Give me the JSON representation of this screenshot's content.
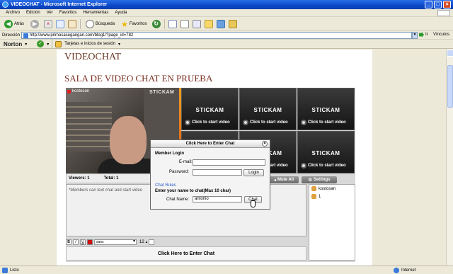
{
  "window": {
    "title": "VIDEOCHAT - Microsoft Internet Explorer"
  },
  "menu": [
    "Archivo",
    "Edición",
    "Ver",
    "Favoritos",
    "Herramientas",
    "Ayuda"
  ],
  "toolbar": {
    "back": "Atrás",
    "search": "Búsqueda",
    "favorites": "Favoritos"
  },
  "address": {
    "label": "Dirección",
    "url": "http://www.primosasegangan.com/blog1/?page_id=782",
    "go": "Ir",
    "links": "Vínculos"
  },
  "norton": {
    "brand": "Norton",
    "cards": "Tarjetas e inicios de sesión"
  },
  "page": {
    "title": "VIDEOCHAT",
    "subtitle": "SALA DE VIDEO CHAT EN PRUEBA"
  },
  "widget": {
    "cam_user": "kostosan",
    "brand": "STICKAM",
    "cta": "Click to start video",
    "viewers": "Viewers: 1",
    "total": "Total: 1",
    "mute_all": "Mute All",
    "settings": "Settings",
    "chat_notice": "*Members can text chat and start video",
    "users": [
      "kostosan",
      "1"
    ],
    "font": "sans",
    "font_size": "12",
    "enter_chat": "Click Here to Enter Chat"
  },
  "dialog": {
    "title": "Click Here to Enter Chat",
    "member_login": "Member Login",
    "email_label": "E-mail:",
    "password_label": "Password:",
    "login_btn": "Login",
    "chat_rules": "Chat Rules",
    "name_prompt": "Enter your name to chat(Max 10 char)",
    "chat_name_label": "Chat Name:",
    "chat_name_value": "antonio",
    "chat_btn": "Chat"
  },
  "status": {
    "left": "Listo",
    "zone": "Internet"
  },
  "colors": {
    "title_bar": "#0a48c8",
    "page_title": "#6b3a26",
    "accent": "#f0a020"
  }
}
